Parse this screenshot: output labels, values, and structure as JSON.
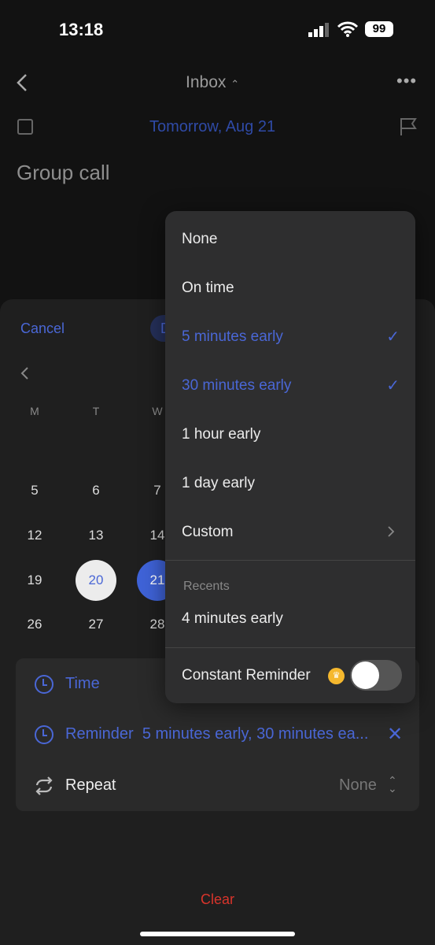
{
  "status_bar": {
    "time": "13:18",
    "battery": "99"
  },
  "header": {
    "title": "Inbox",
    "due": "Tomorrow, Aug 21",
    "task_title": "Group call"
  },
  "sheet": {
    "cancel": "Cancel",
    "done_partial": "D",
    "weekdays": [
      "M",
      "T",
      "W"
    ],
    "rows": [
      [
        "5",
        "6",
        "7"
      ],
      [
        "12",
        "13",
        "14"
      ],
      [
        "19",
        "20",
        "21"
      ],
      [
        "26",
        "27",
        "28"
      ]
    ],
    "today": "20",
    "selected": "21"
  },
  "options": {
    "time_label": "Time",
    "reminder_label": "Reminder",
    "reminder_value": "5 minutes early, 30 minutes ea...",
    "repeat_label": "Repeat",
    "repeat_value": "None",
    "clear": "Clear"
  },
  "menu": {
    "items": [
      {
        "label": "None",
        "checked": false
      },
      {
        "label": "On time",
        "checked": false
      },
      {
        "label": "5 minutes early",
        "checked": true
      },
      {
        "label": "30 minutes early",
        "checked": true
      },
      {
        "label": "1 hour early",
        "checked": false
      },
      {
        "label": "1 day early",
        "checked": false
      },
      {
        "label": "Custom",
        "checked": false
      }
    ],
    "recents_header": "Recents",
    "recent_item": "4 minutes early",
    "constant_reminder": "Constant Reminder",
    "constant_reminder_on": false
  },
  "colors": {
    "accent": "#4a67d6",
    "clear": "#d9342b",
    "premium": "#f5b82e"
  }
}
